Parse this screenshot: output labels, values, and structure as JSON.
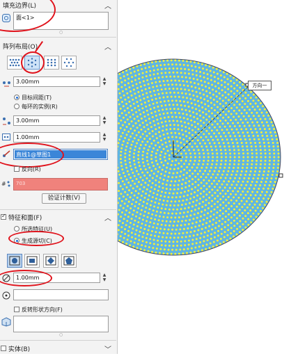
{
  "fill_boundary": {
    "title": "填充边界(L)",
    "value": "面<1>"
  },
  "pattern_layout": {
    "title": "阵列布局(O)",
    "spacing": "3.00mm",
    "option_target_spacing": "目标间距(T)",
    "option_instances_per_ring": "每环的实例(R)",
    "ring_spacing": "3.00mm",
    "margin": "1.00mm",
    "direction_ref": "直线1@草图1",
    "reverse": "反向(R)",
    "instance_count": "703",
    "verify_button": "验证计数(V)"
  },
  "features": {
    "title": "特征和面(F)",
    "option_selected": "所选特征(U)",
    "option_generate": "生成源切(C)",
    "diameter": "1.00mm",
    "flip_shape": "反转形状方向(F)"
  },
  "solid": {
    "title": "实体(B)"
  },
  "canvas": {
    "callout_label": "方向一",
    "origin_label": "原点"
  },
  "colors": {
    "fill": "#5fb5e3",
    "dots": "#f2ee3c",
    "annotation": "#e0131c",
    "count_bg": "#f0827c"
  }
}
